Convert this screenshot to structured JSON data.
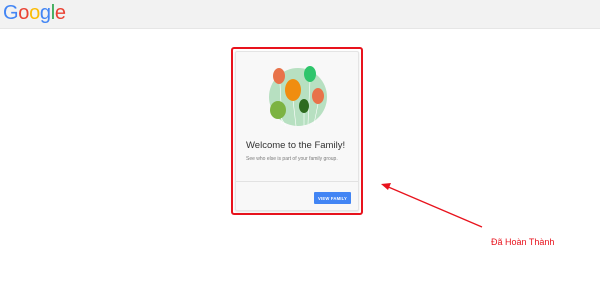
{
  "header": {
    "logo_letters": [
      "G",
      "o",
      "o",
      "g",
      "l",
      "e"
    ]
  },
  "card": {
    "title": "Welcome to the Family!",
    "subtitle": "See who else is part of your family group.",
    "button_label": "VIEW FAMILY",
    "illustration_icon": "balloons-icon"
  },
  "annotation": {
    "label": "Đã Hoàn Thành",
    "color": "#e8131d"
  },
  "colors": {
    "google_blue": "#4285f4",
    "google_red": "#ea4335",
    "google_yellow": "#fbbc05",
    "google_green": "#34a853",
    "button_blue": "#4285f4"
  }
}
